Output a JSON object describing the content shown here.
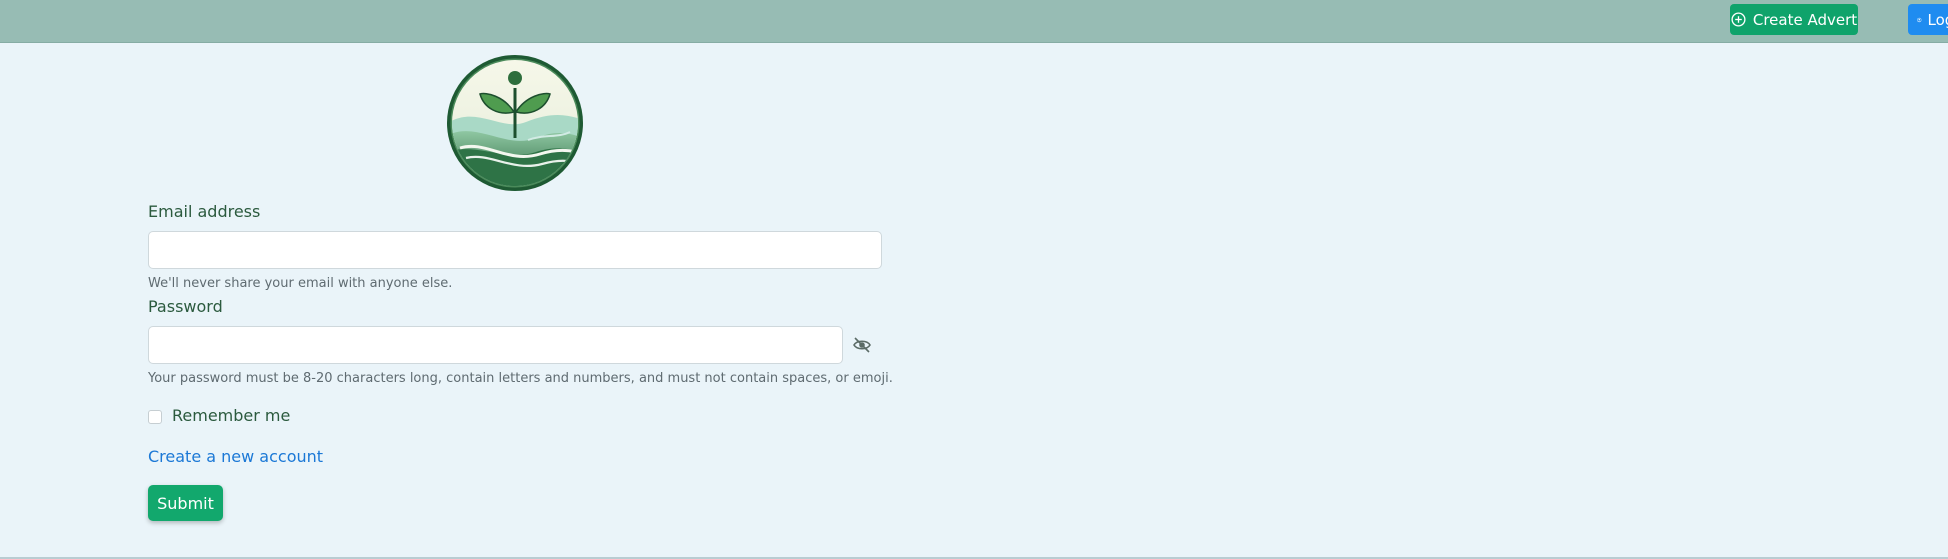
{
  "header": {
    "create_advert_label": "Create Advert",
    "create_advert_icon": "plus-circle-icon",
    "login_label": "Login",
    "login_icon": "user-circle-icon"
  },
  "form": {
    "email_label": "Email address",
    "email_value": "",
    "email_help": "We'll never share your email with anyone else.",
    "password_label": "Password",
    "password_value": "",
    "password_help": "Your password must be 8-20 characters long, contain letters and numbers, and must not contain spaces, or emoji.",
    "password_toggle_icon": "eye-slash-icon",
    "remember_label": "Remember me",
    "remember_checked": false,
    "create_account_link": "Create a new account",
    "submit_label": "Submit"
  },
  "logo_icon": "sprout-logo-icon",
  "colors": {
    "topbar": "#97bcb4",
    "background": "#eaf4f9",
    "create_button": "#0fa36b",
    "login_button": "#1f8cf0",
    "submit_button": "#12a86d",
    "link": "#1b78d6",
    "label_text": "#2b5a3e"
  }
}
